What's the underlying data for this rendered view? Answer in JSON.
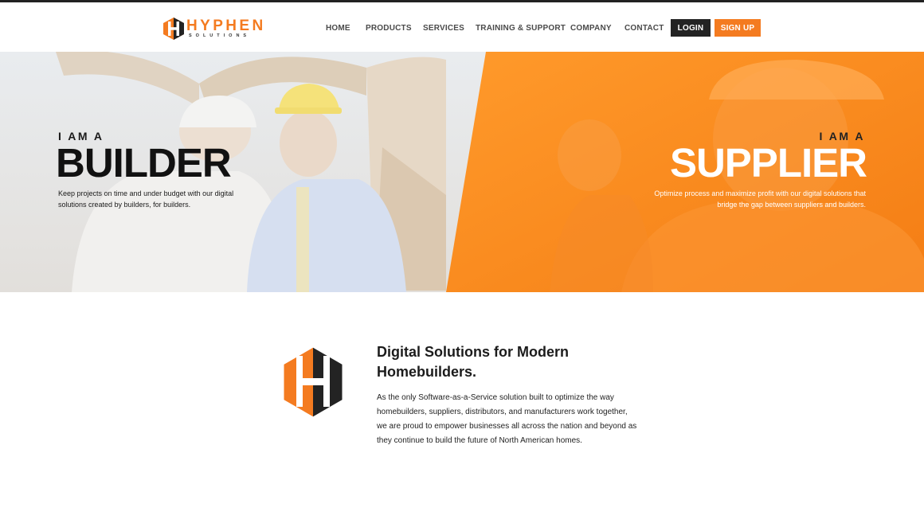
{
  "brand": {
    "name": "HYPHEN",
    "tagline": "SOLUTIONS",
    "orange": "#f47b20",
    "dark": "#232323"
  },
  "nav": {
    "items": [
      "HOME",
      "PRODUCTS",
      "SERVICES",
      "TRAINING & SUPPORT",
      "COMPANY",
      "CONTACT"
    ],
    "login_label": "LOGIN",
    "signup_label": "SIGN UP"
  },
  "hero": {
    "builder": {
      "eyebrow": "I AM A",
      "title": "BUILDER",
      "description": "Keep projects on time and under budget with our digital solutions created by builders, for builders."
    },
    "supplier": {
      "eyebrow": "I AM A",
      "title": "SUPPLIER",
      "description": "Optimize process and maximize profit with our digital solutions that bridge the gap between suppliers and builders."
    }
  },
  "about": {
    "title": "Digital Solutions for Modern Homebuilders.",
    "body": "As the only Software-as-a-Service solution built to optimize the way homebuilders, suppliers, distributors, and manufacturers work together, we are proud to empower businesses all across the nation and beyond as they continue to build the future of North American homes."
  }
}
